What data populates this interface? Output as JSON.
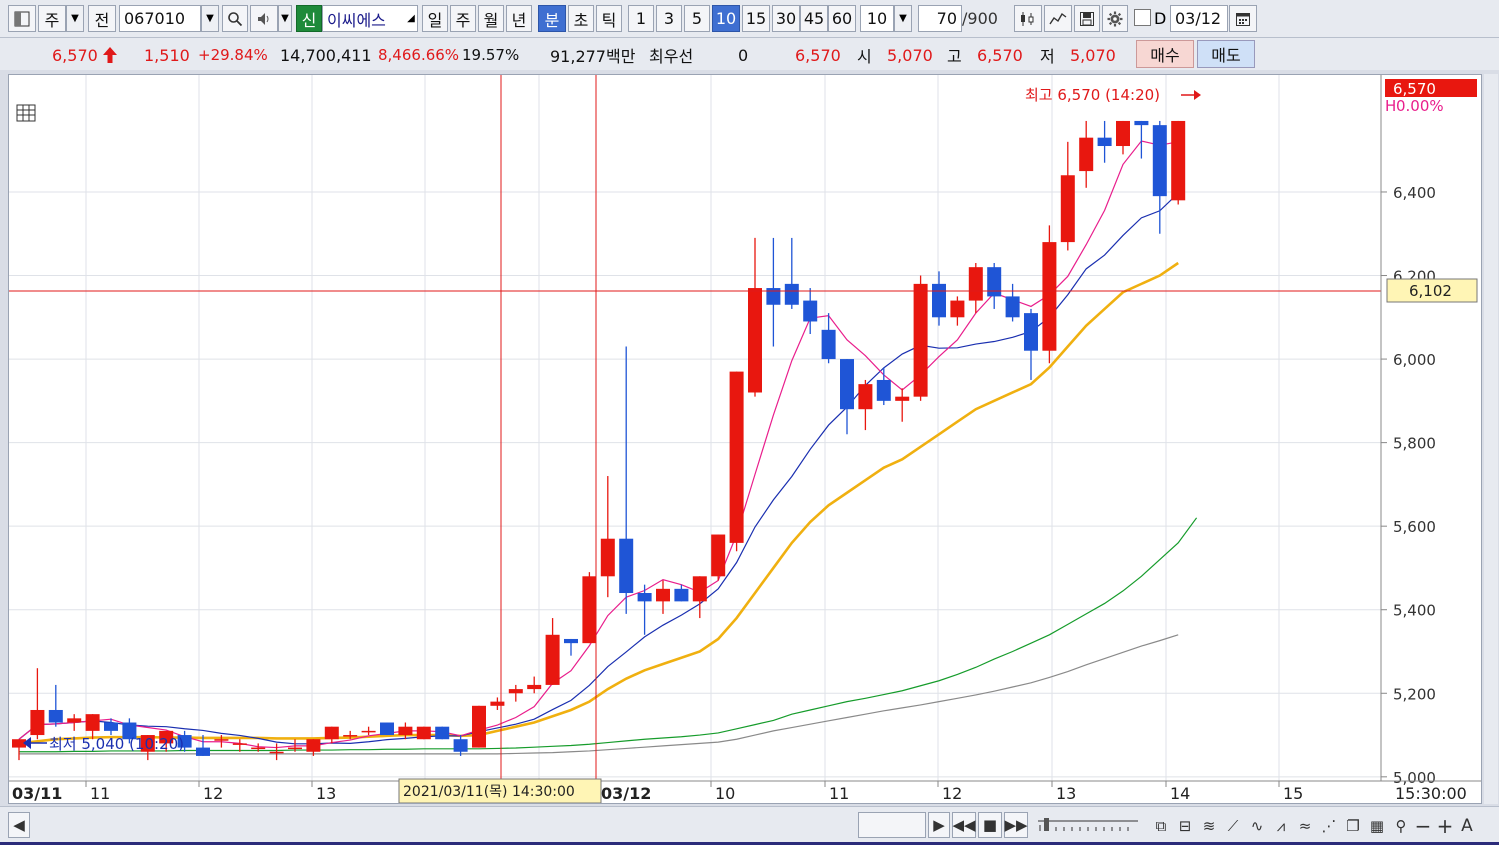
{
  "toolbar": {
    "market_type": "주",
    "prev_label": "전",
    "stock_code": "067010",
    "credit_label": "신",
    "stock_name": "이씨에스",
    "periods": [
      "일",
      "주",
      "월",
      "년",
      "분",
      "초",
      "틱"
    ],
    "selected_period": "분",
    "intervals": [
      "1",
      "3",
      "5",
      "10",
      "15",
      "30",
      "45",
      "60"
    ],
    "selected_interval": "10",
    "interval_value": "10",
    "count_value": "70",
    "count_total": "/900",
    "date_checkbox_label": "D",
    "date_value": "03/12"
  },
  "quote": {
    "price": "6,570",
    "change": "1,510",
    "change_pct": "+29.84%",
    "volume": "14,700,411",
    "volume_ratio": "8,466.66%",
    "turnover": "19.57%",
    "amount": "91,277백만",
    "priority_label": "최우선",
    "priority_value": "0",
    "ask_price": "6,570",
    "open_label": "시",
    "open": "5,070",
    "high_label": "고",
    "high": "6,570",
    "low_label": "저",
    "low": "5,070",
    "buy_label": "매수",
    "sell_label": "매도"
  },
  "chart": {
    "high_annotation": "최고 6,570 (14:20)",
    "low_annotation": "최저 5,040 (10:20)",
    "current_price_tag": "6,570",
    "current_pct_tag": "0.00%",
    "cursor_price_tag": "6,102",
    "cursor_time_label": "2021/03/11(목) 14:30:00",
    "date_label_1": "03/11",
    "date_label_2": "03/12",
    "end_time_label": "15:30:00",
    "x_hour_labels": [
      "11",
      "12",
      "13",
      "10",
      "11",
      "12",
      "13",
      "14",
      "15"
    ],
    "y_ticks": [
      "6,400",
      "6,200",
      "6,000",
      "5,800",
      "5,600",
      "5,400",
      "5,200",
      "5,000"
    ],
    "colors": {
      "up": "#e8170f",
      "down": "#1f55d6",
      "ma5": "#e91e8c",
      "ma10": "#1a2fb0",
      "ma20": "#f0b010",
      "ma60": "#169c2b",
      "ma120": "#8a8a8a",
      "cursor": "#e0191a"
    }
  },
  "chart_data": {
    "type": "candlestick",
    "interval": "10분",
    "y_range": [
      5000,
      6570
    ],
    "candles": [
      {
        "o": 5070,
        "h": 5090,
        "l": 5040,
        "c": 5090
      },
      {
        "o": 5100,
        "h": 5260,
        "l": 5090,
        "c": 5160
      },
      {
        "o": 5160,
        "h": 5220,
        "l": 5120,
        "c": 5130
      },
      {
        "o": 5130,
        "h": 5150,
        "l": 5110,
        "c": 5140
      },
      {
        "o": 5110,
        "h": 5150,
        "l": 5090,
        "c": 5150
      },
      {
        "o": 5130,
        "h": 5140,
        "l": 5100,
        "c": 5110
      },
      {
        "o": 5130,
        "h": 5140,
        "l": 5080,
        "c": 5090
      },
      {
        "o": 5060,
        "h": 5100,
        "l": 5040,
        "c": 5100
      },
      {
        "o": 5080,
        "h": 5110,
        "l": 5060,
        "c": 5110
      },
      {
        "o": 5100,
        "h": 5110,
        "l": 5060,
        "c": 5070
      },
      {
        "o": 5070,
        "h": 5100,
        "l": 5050,
        "c": 5050
      },
      {
        "o": 5090,
        "h": 5100,
        "l": 5070,
        "c": 5090
      },
      {
        "o": 5080,
        "h": 5090,
        "l": 5060,
        "c": 5080
      },
      {
        "o": 5070,
        "h": 5080,
        "l": 5060,
        "c": 5070
      },
      {
        "o": 5060,
        "h": 5080,
        "l": 5040,
        "c": 5060
      },
      {
        "o": 5070,
        "h": 5090,
        "l": 5060,
        "c": 5070
      },
      {
        "o": 5060,
        "h": 5090,
        "l": 5050,
        "c": 5090
      },
      {
        "o": 5090,
        "h": 5120,
        "l": 5080,
        "c": 5120
      },
      {
        "o": 5100,
        "h": 5110,
        "l": 5090,
        "c": 5100
      },
      {
        "o": 5110,
        "h": 5120,
        "l": 5100,
        "c": 5110
      },
      {
        "o": 5130,
        "h": 5130,
        "l": 5100,
        "c": 5100
      },
      {
        "o": 5100,
        "h": 5130,
        "l": 5090,
        "c": 5120
      },
      {
        "o": 5090,
        "h": 5120,
        "l": 5090,
        "c": 5120
      },
      {
        "o": 5120,
        "h": 5120,
        "l": 5090,
        "c": 5090
      },
      {
        "o": 5090,
        "h": 5100,
        "l": 5050,
        "c": 5060
      },
      {
        "o": 5070,
        "h": 5170,
        "l": 5070,
        "c": 5170
      },
      {
        "o": 5170,
        "h": 5190,
        "l": 5160,
        "c": 5180
      },
      {
        "o": 5200,
        "h": 5220,
        "l": 5180,
        "c": 5210
      },
      {
        "o": 5210,
        "h": 5240,
        "l": 5200,
        "c": 5220
      },
      {
        "o": 5220,
        "h": 5380,
        "l": 5220,
        "c": 5340
      },
      {
        "o": 5330,
        "h": 5330,
        "l": 5290,
        "c": 5320
      },
      {
        "o": 5320,
        "h": 5490,
        "l": 5320,
        "c": 5480
      },
      {
        "o": 5480,
        "h": 5720,
        "l": 5430,
        "c": 5570
      },
      {
        "o": 5570,
        "h": 6030,
        "l": 5390,
        "c": 5440
      },
      {
        "o": 5440,
        "h": 5460,
        "l": 5340,
        "c": 5420
      },
      {
        "o": 5420,
        "h": 5470,
        "l": 5390,
        "c": 5450
      },
      {
        "o": 5450,
        "h": 5460,
        "l": 5420,
        "c": 5420
      },
      {
        "o": 5420,
        "h": 5480,
        "l": 5380,
        "c": 5480
      },
      {
        "o": 5480,
        "h": 5580,
        "l": 5470,
        "c": 5580
      },
      {
        "o": 5560,
        "h": 5970,
        "l": 5540,
        "c": 5970
      },
      {
        "o": 5920,
        "h": 6290,
        "l": 5910,
        "c": 6170
      },
      {
        "o": 6170,
        "h": 6290,
        "l": 6030,
        "c": 6130
      },
      {
        "o": 6180,
        "h": 6290,
        "l": 6120,
        "c": 6130
      },
      {
        "o": 6140,
        "h": 6170,
        "l": 6060,
        "c": 6090
      },
      {
        "o": 6070,
        "h": 6110,
        "l": 5990,
        "c": 6000
      },
      {
        "o": 6000,
        "h": 6000,
        "l": 5820,
        "c": 5880
      },
      {
        "o": 5880,
        "h": 5950,
        "l": 5830,
        "c": 5940
      },
      {
        "o": 5950,
        "h": 5980,
        "l": 5890,
        "c": 5900
      },
      {
        "o": 5900,
        "h": 5930,
        "l": 5850,
        "c": 5910
      },
      {
        "o": 5910,
        "h": 6200,
        "l": 5900,
        "c": 6180
      },
      {
        "o": 6180,
        "h": 6210,
        "l": 6080,
        "c": 6100
      },
      {
        "o": 6100,
        "h": 6150,
        "l": 6080,
        "c": 6140
      },
      {
        "o": 6140,
        "h": 6230,
        "l": 6110,
        "c": 6220
      },
      {
        "o": 6220,
        "h": 6230,
        "l": 6120,
        "c": 6150
      },
      {
        "o": 6150,
        "h": 6180,
        "l": 6090,
        "c": 6100
      },
      {
        "o": 6110,
        "h": 6120,
        "l": 5950,
        "c": 6020
      },
      {
        "o": 6020,
        "h": 6320,
        "l": 5990,
        "c": 6280
      },
      {
        "o": 6280,
        "h": 6520,
        "l": 6260,
        "c": 6440
      },
      {
        "o": 6450,
        "h": 6570,
        "l": 6410,
        "c": 6530
      },
      {
        "o": 6530,
        "h": 6570,
        "l": 6470,
        "c": 6510
      },
      {
        "o": 6510,
        "h": 6570,
        "l": 6490,
        "c": 6570
      },
      {
        "o": 6570,
        "h": 6570,
        "l": 6480,
        "c": 6560
      },
      {
        "o": 6560,
        "h": 6570,
        "l": 6300,
        "c": 6390
      },
      {
        "o": 6380,
        "h": 6570,
        "l": 6370,
        "c": 6570
      }
    ],
    "ma20": [
      5080,
      5085,
      5090,
      5092,
      5094,
      5095,
      5095,
      5095,
      5094,
      5094,
      5093,
      5093,
      5093,
      5093,
      5092,
      5092,
      5092,
      5093,
      5094,
      5096,
      5098,
      5100,
      5100,
      5100,
      5098,
      5100,
      5110,
      5120,
      5130,
      5145,
      5160,
      5180,
      5210,
      5235,
      5255,
      5270,
      5285,
      5300,
      5330,
      5380,
      5440,
      5500,
      5560,
      5610,
      5650,
      5680,
      5710,
      5740,
      5760,
      5790,
      5820,
      5850,
      5880,
      5900,
      5920,
      5940,
      5980,
      6030,
      6080,
      6120,
      6160,
      6180,
      6200,
      6230
    ],
    "ma60": [
      5060,
      5060,
      5060,
      5061,
      5061,
      5062,
      5062,
      5062,
      5062,
      5063,
      5063,
      5063,
      5063,
      5063,
      5063,
      5064,
      5064,
      5064,
      5065,
      5065,
      5066,
      5066,
      5067,
      5067,
      5067,
      5067,
      5068,
      5069,
      5071,
      5073,
      5075,
      5078,
      5082,
      5086,
      5090,
      5093,
      5096,
      5100,
      5105,
      5115,
      5125,
      5135,
      5150,
      5160,
      5170,
      5180,
      5188,
      5197,
      5206,
      5218,
      5230,
      5245,
      5262,
      5282,
      5300,
      5320,
      5340,
      5365,
      5390,
      5415,
      5445,
      5480,
      5520,
      5560,
      5620
    ],
    "ma120": [
      5055,
      5055,
      5055,
      5055,
      5055,
      5055,
      5055,
      5055,
      5055,
      5055,
      5055,
      5055,
      5055,
      5055,
      5055,
      5055,
      5055,
      5055,
      5055,
      5055,
      5055,
      5055,
      5055,
      5055,
      5055,
      5055,
      5055,
      5056,
      5057,
      5058,
      5060,
      5062,
      5065,
      5068,
      5071,
      5074,
      5077,
      5080,
      5083,
      5090,
      5100,
      5110,
      5118,
      5126,
      5134,
      5142,
      5150,
      5158,
      5165,
      5172,
      5180,
      5188,
      5196,
      5205,
      5215,
      5225,
      5238,
      5252,
      5268,
      5283,
      5298,
      5313,
      5326,
      5340
    ]
  },
  "bottom": {
    "scroll_left": "◀"
  }
}
